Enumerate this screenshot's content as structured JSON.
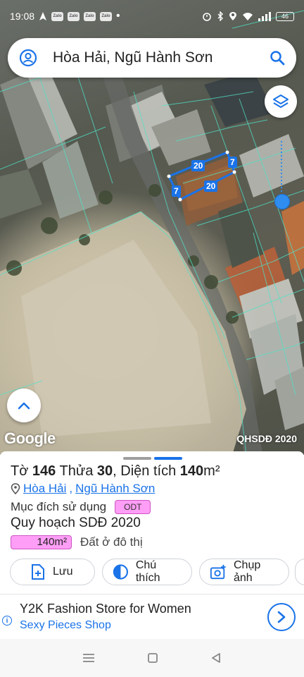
{
  "status_bar": {
    "time": "19:08",
    "notification_icons": [
      "Zalo",
      "Zalo",
      "Zalo",
      "Zalo"
    ],
    "battery": "46"
  },
  "search": {
    "value": "Hòa Hải, Ngũ Hành Sơn"
  },
  "map": {
    "parcel_sides": [
      "20",
      "7",
      "20",
      "7"
    ],
    "provider": "Google",
    "layer_name": "QHSDĐ 2020"
  },
  "parcel": {
    "sheet_label": "Tờ",
    "sheet_number": "146",
    "lot_label": "Thửa",
    "lot_number": "30",
    "area_label": "Diện tích",
    "area_value": "140",
    "area_unit": "m²",
    "ward": "Hòa Hải",
    "district": "Ngũ Hành Sơn",
    "purpose_label": "Mục đích sử dụng",
    "purpose_code": "ODT",
    "plan_label": "Quy hoạch SDĐ 2020",
    "plan_area": "140m²",
    "plan_desc": "Đất ở đô thị"
  },
  "actions": {
    "save": "Lưu",
    "legend": "Chú thích",
    "capture": "Chụp ảnh"
  },
  "ad": {
    "title": "Y2K Fashion Store for Women",
    "subtitle": "Sexy Pieces Shop"
  },
  "colors": {
    "accent": "#1a73e8",
    "land_use_pink": "#ff9ef6",
    "parcel_line": "#1a73e8",
    "cadastral_line": "#4fe3c8"
  }
}
